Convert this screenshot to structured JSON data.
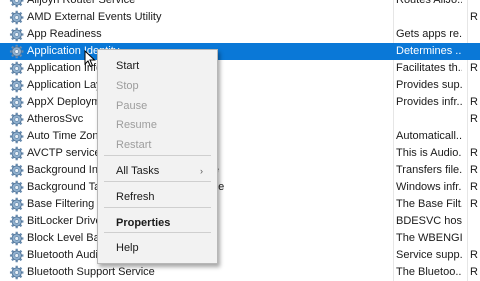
{
  "services": [
    {
      "name": "Alljoyn Router Service",
      "desc": "Routes AllJo...",
      "status": "",
      "selected": false
    },
    {
      "name": "AMD External Events Utility",
      "desc": "",
      "status": "R",
      "selected": false
    },
    {
      "name": "App Readiness",
      "desc": "Gets apps re...",
      "status": "",
      "selected": false
    },
    {
      "name": "Application Identity",
      "desc": "Determines ...",
      "status": "",
      "selected": true
    },
    {
      "name": "Application Information",
      "desc": "Facilitates th...",
      "status": "R",
      "selected": false
    },
    {
      "name": "Application Layer Gateway Service",
      "desc": "Provides sup...",
      "status": "",
      "selected": false
    },
    {
      "name": "AppX Deployment Service",
      "desc": "Provides infr...",
      "status": "R",
      "selected": false
    },
    {
      "name": "AtherosSvc",
      "desc": "",
      "status": "R",
      "selected": false
    },
    {
      "name": "Auto Time Zone Updater",
      "desc": "Automaticall...",
      "status": "",
      "selected": false
    },
    {
      "name": "AVCTP service",
      "desc": "This is Audio...",
      "status": "R",
      "selected": false
    },
    {
      "name": "Background Intelligent Transfer Service",
      "desc": "Transfers file...",
      "status": "R",
      "selected": false
    },
    {
      "name": "Background Tasks Infrastructure Service",
      "desc": "Windows infr...",
      "status": "R",
      "selected": false
    },
    {
      "name": "Base Filtering Engine",
      "desc": "The Base Filt...",
      "status": "R",
      "selected": false
    },
    {
      "name": "BitLocker Drive Encryption Service",
      "desc": "BDESVC hos...",
      "status": "",
      "selected": false
    },
    {
      "name": "Block Level Backup Engine Service",
      "desc": "The WBENGI...",
      "status": "",
      "selected": false
    },
    {
      "name": "Bluetooth Audio Gateway Service",
      "desc": "Service supp...",
      "status": "R",
      "selected": false
    },
    {
      "name": "Bluetooth Support Service",
      "desc": "The Bluetoo...",
      "status": "R",
      "selected": false
    }
  ],
  "context_menu": {
    "items": [
      {
        "label": "Start",
        "enabled": true,
        "bold": false,
        "submenu": false
      },
      {
        "label": "Stop",
        "enabled": false,
        "bold": false,
        "submenu": false
      },
      {
        "label": "Pause",
        "enabled": false,
        "bold": false,
        "submenu": false
      },
      {
        "label": "Resume",
        "enabled": false,
        "bold": false,
        "submenu": false
      },
      {
        "label": "Restart",
        "enabled": false,
        "bold": false,
        "submenu": false
      },
      {
        "label": "All Tasks",
        "enabled": true,
        "bold": false,
        "submenu": true
      },
      {
        "label": "Refresh",
        "enabled": true,
        "bold": false,
        "submenu": false
      },
      {
        "label": "Properties",
        "enabled": true,
        "bold": true,
        "submenu": false
      },
      {
        "label": "Help",
        "enabled": true,
        "bold": false,
        "submenu": false
      }
    ],
    "submenu_arrow": "›"
  },
  "icons": {
    "service": "gear-icon",
    "cursor": "mouse-pointer-icon"
  },
  "colors": {
    "selection": "#0a78d7",
    "disabled_text": "#9d9d9d",
    "menu_bg": "#f2f2f2"
  }
}
